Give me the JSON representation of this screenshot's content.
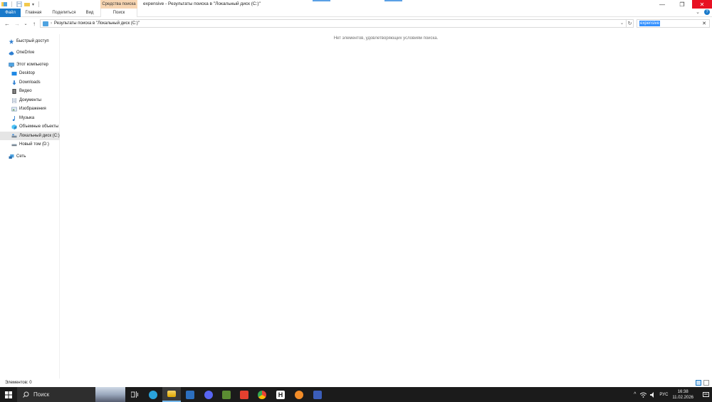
{
  "window": {
    "title": "expensive - Результаты поиска в \"Локальный диск (C:)\"",
    "context_tab_group": "Средства поиска",
    "controls": {
      "minimize": "—",
      "restore": "❐",
      "close": "✕"
    }
  },
  "ribbon": {
    "tabs": [
      "Файл",
      "Главная",
      "Поделиться",
      "Вид",
      "Поиск"
    ],
    "expand_glyph": "⌄",
    "help_glyph": "?"
  },
  "navigation": {
    "back": "←",
    "forward": "→",
    "history": "⌄",
    "up": "↑"
  },
  "address": {
    "chevron": "›",
    "path": "Результаты поиска в \"Локальный диск (C:)\"",
    "dropdown": "⌄",
    "refresh": "↻"
  },
  "search": {
    "query": "expensive",
    "clear": "✕"
  },
  "nav_pane": {
    "items": [
      {
        "label": "Быстрый доступ",
        "icon": "star-icon"
      },
      {
        "label": "OneDrive",
        "icon": "cloud-icon"
      },
      {
        "label": "Этот компьютер",
        "icon": "computer-icon"
      },
      {
        "label": "Desktop",
        "icon": "desktop-folder-icon"
      },
      {
        "label": "Downloads",
        "icon": "download-arrow-icon"
      },
      {
        "label": "Видео",
        "icon": "video-icon"
      },
      {
        "label": "Документы",
        "icon": "document-icon"
      },
      {
        "label": "Изображения",
        "icon": "pictures-icon"
      },
      {
        "label": "Музыка",
        "icon": "music-note-icon"
      },
      {
        "label": "Объемные объекты",
        "icon": "cube-icon"
      },
      {
        "label": "Локальный диск (C:)",
        "icon": "drive-icon",
        "selected": true
      },
      {
        "label": "Новый том (D:)",
        "icon": "drive-icon"
      },
      {
        "label": "Сеть",
        "icon": "network-icon"
      }
    ]
  },
  "content": {
    "empty_message": "Нет элементов, удовлетворяющих условиям поиска."
  },
  "status": {
    "items_count": "Элементов: 0"
  },
  "taskbar": {
    "search_placeholder": "Поиск",
    "apps": [
      "task-view",
      "telegram",
      "file-explorer",
      "settings-app",
      "discord",
      "minecraft",
      "screen-recorder",
      "chrome",
      "hh-app",
      "search-app",
      "photo-app"
    ],
    "language": "РУС",
    "time": "16:38",
    "date": "11.02.2026",
    "tray_chevron": "^"
  },
  "colors": {
    "accent": "#1979ca",
    "context_tab": "#f7d5b2",
    "close_button": "#e81123",
    "taskbar": "#1b1b1b"
  }
}
